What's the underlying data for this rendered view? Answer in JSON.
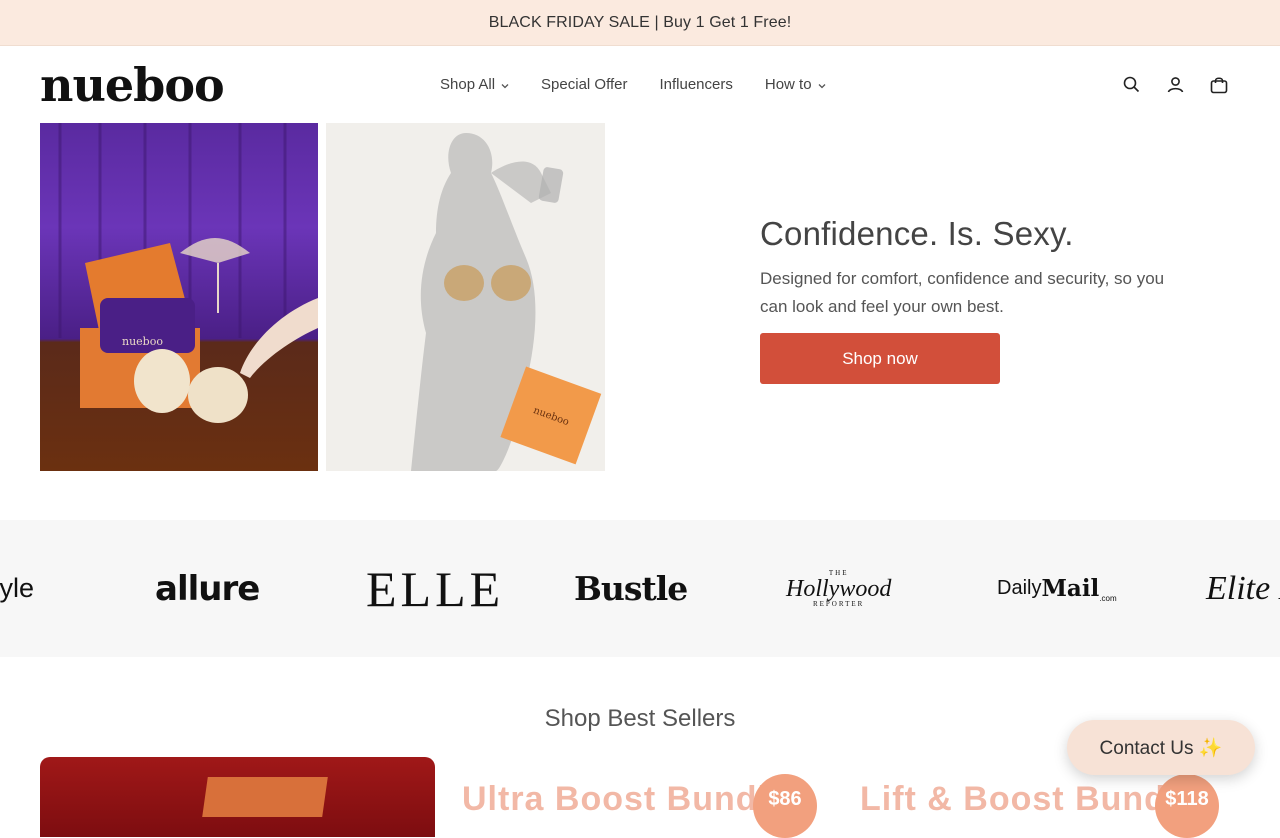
{
  "announcement": {
    "text": "BLACK FRIDAY SALE | Buy 1 Get 1 Free!"
  },
  "header": {
    "logo": "nueboo",
    "nav": [
      {
        "label": "Shop All",
        "has_dropdown": true
      },
      {
        "label": "Special Offer",
        "has_dropdown": false
      },
      {
        "label": "Influencers",
        "has_dropdown": false
      },
      {
        "label": "How to",
        "has_dropdown": true
      }
    ],
    "icons": [
      "search-icon",
      "account-icon",
      "cart-icon"
    ]
  },
  "hero": {
    "title": "Confidence. Is. Sexy.",
    "description": "Designed for comfort, confidence and security, so you can look and feel your own best.",
    "cta_label": "Shop now",
    "cta_color": "#d24f3a",
    "left_image_box_logo": "nueboo",
    "right_image_box_logo": "nueboo"
  },
  "press": {
    "logos": [
      "tyle",
      "allure",
      "ELLE",
      "Bustle",
      "Hollywood",
      "Daily",
      "Mail",
      "Elite D"
    ],
    "hollywood_top": "THE",
    "hollywood_bottom": "REPORTER",
    "dailymail_suffix": ".com"
  },
  "best_sellers": {
    "title": "Shop Best Sellers",
    "products": [
      {
        "name": "Ultra Boost Bundle",
        "price": "$86"
      },
      {
        "name": "Lift & Boost Bundle",
        "price": "$118"
      }
    ]
  },
  "contact": {
    "label": "Contact Us ✨"
  },
  "colors": {
    "announcement_bg": "#fbeadf",
    "accent": "#d24f3a",
    "contact_bg": "#f7e2d6"
  }
}
